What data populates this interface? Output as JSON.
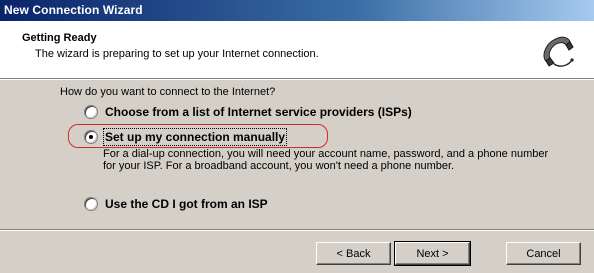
{
  "window": {
    "title": "New Connection Wizard"
  },
  "header": {
    "title": "Getting Ready",
    "subtitle": "The wizard is preparing to set up your Internet connection.",
    "icon": "telephone-handset-icon"
  },
  "main": {
    "question": "How do you want to connect to the Internet?",
    "options": [
      {
        "label": "Choose from a list of Internet service providers (ISPs)",
        "selected": false
      },
      {
        "label": "Set up my connection manually",
        "selected": true
      },
      {
        "label": "Use the CD I got from an ISP",
        "selected": false
      }
    ],
    "manual_description": "For a dial-up connection, you will need your account name, password, and a phone number for your ISP. For a broadband account, you won't need a phone number."
  },
  "footer": {
    "back_label": "< Back",
    "next_label": "Next >",
    "cancel_label": "Cancel"
  },
  "colors": {
    "title_bar_start": "#0a246a",
    "title_bar_end": "#a6caf0",
    "dialog_face": "#d4d0c8",
    "annotation_red": "#d42a2a"
  }
}
